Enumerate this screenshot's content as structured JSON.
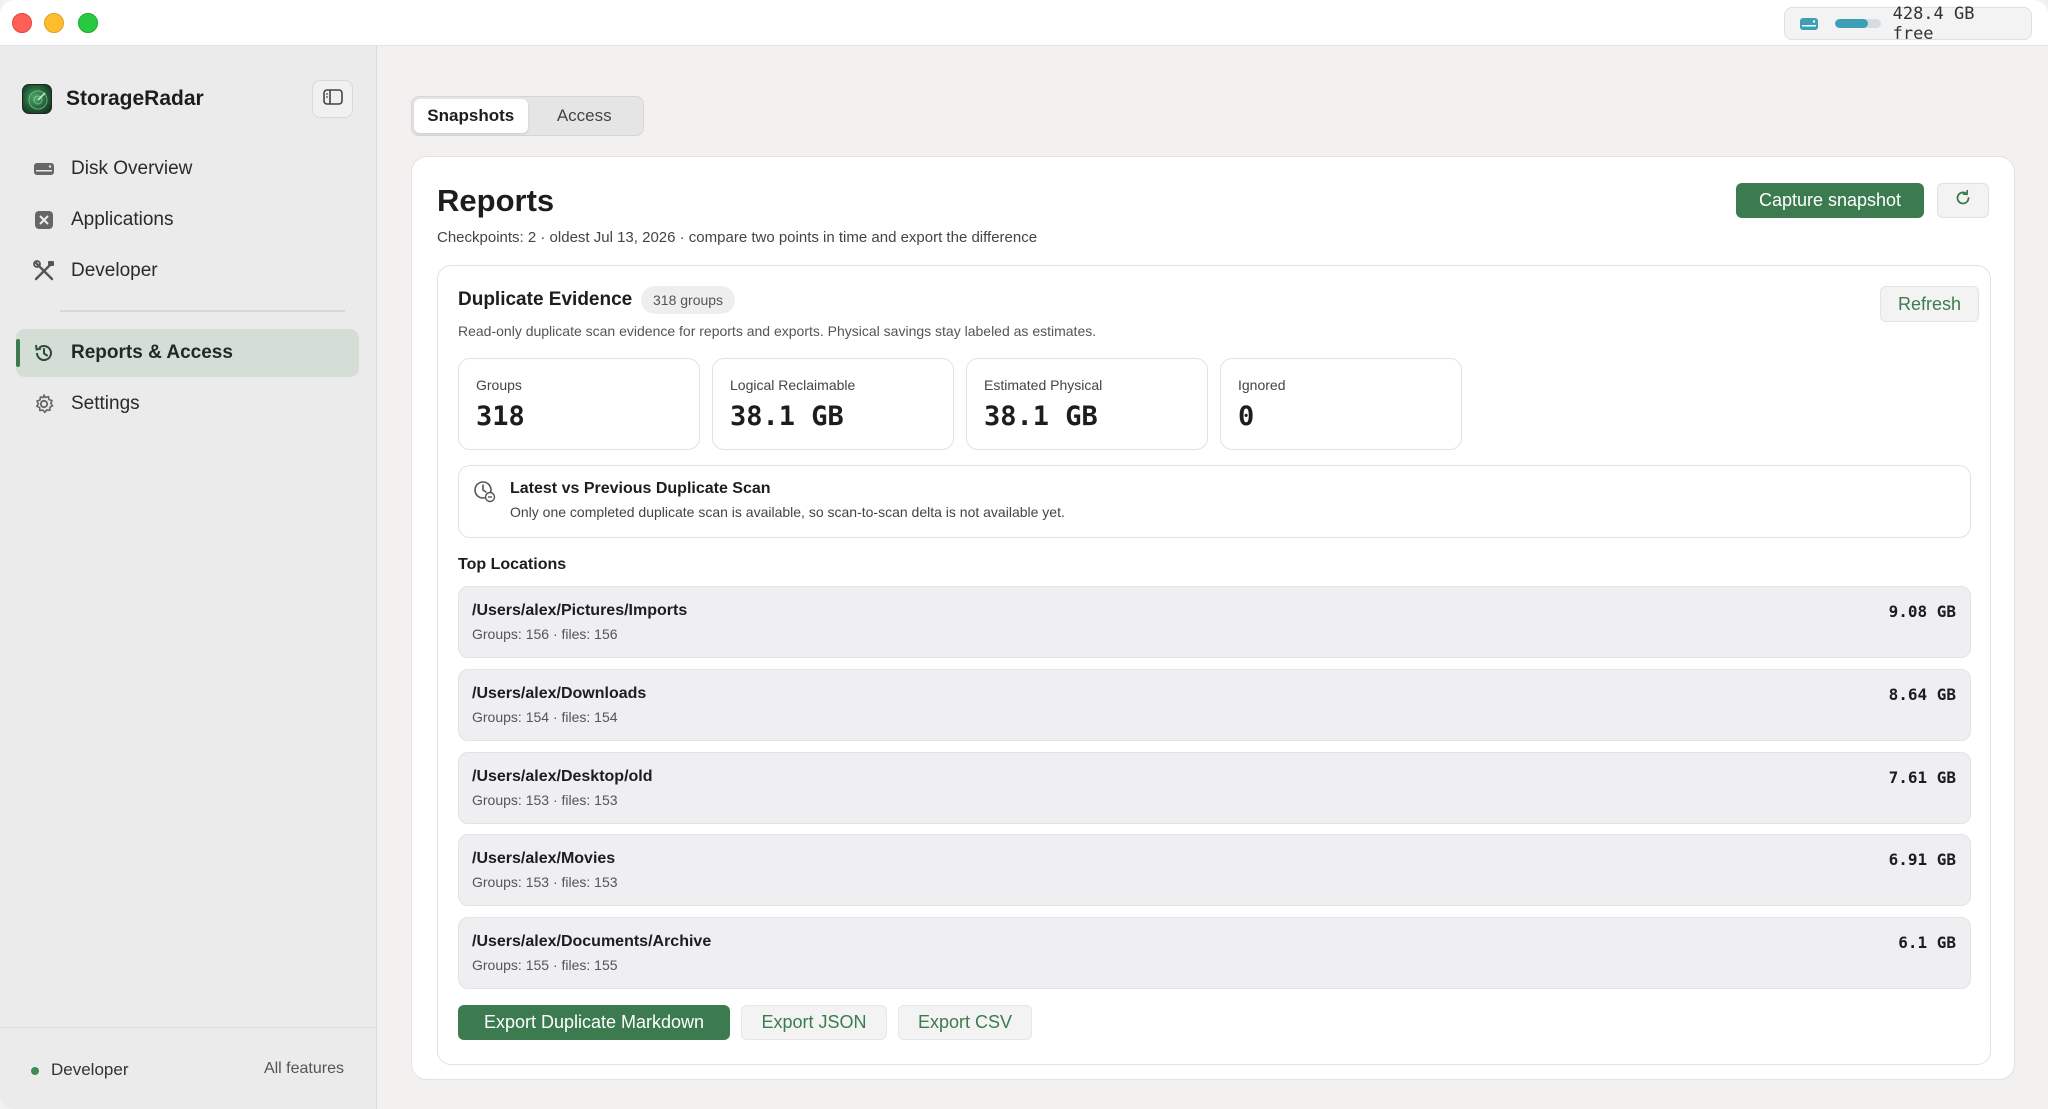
{
  "app": {
    "name": "StorageRadar"
  },
  "titlebar": {
    "disk_free": "428.4 GB free",
    "disk_used_fraction": 0.72
  },
  "sidebar": {
    "items": [
      {
        "label": "Disk Overview",
        "icon": "disk-icon"
      },
      {
        "label": "Applications",
        "icon": "applications-icon"
      },
      {
        "label": "Developer",
        "icon": "tools-icon"
      },
      {
        "label": "Reports & Access",
        "icon": "history-icon"
      },
      {
        "label": "Settings",
        "icon": "gear-icon"
      }
    ],
    "footer": {
      "mode": "Developer",
      "features": "All features"
    }
  },
  "tabs": {
    "snapshots": "Snapshots",
    "access": "Access"
  },
  "reports": {
    "title": "Reports",
    "subtitle": "Checkpoints: 2 · oldest Jul 13, 2026  ·  compare two points in time and export the difference",
    "capture_label": "Capture snapshot"
  },
  "duplicates": {
    "title": "Duplicate Evidence",
    "badge": "318 groups",
    "description": "Read-only duplicate scan evidence for reports and exports. Physical savings stay labeled as estimates.",
    "refresh_label": "Refresh",
    "stats": [
      {
        "label": "Groups",
        "value": "318"
      },
      {
        "label": "Logical Reclaimable",
        "value": "38.1 GB"
      },
      {
        "label": "Estimated Physical",
        "value": "38.1 GB"
      },
      {
        "label": "Ignored",
        "value": "0"
      }
    ],
    "compare": {
      "title": "Latest vs Previous Duplicate Scan",
      "text": "Only one completed duplicate scan is available, so scan-to-scan delta is not available yet."
    },
    "top_locations_label": "Top Locations",
    "locations": [
      {
        "path": "/Users/alex/Pictures/Imports",
        "meta": "Groups: 156 · files: 156",
        "size": "9.08 GB"
      },
      {
        "path": "/Users/alex/Downloads",
        "meta": "Groups: 154 · files: 154",
        "size": "8.64 GB"
      },
      {
        "path": "/Users/alex/Desktop/old",
        "meta": "Groups: 153 · files: 153",
        "size": "7.61 GB"
      },
      {
        "path": "/Users/alex/Movies",
        "meta": "Groups: 153 · files: 153",
        "size": "6.91 GB"
      },
      {
        "path": "/Users/alex/Documents/Archive",
        "meta": "Groups: 155 · files: 155",
        "size": "6.1 GB"
      }
    ],
    "export": {
      "markdown": "Export Duplicate Markdown",
      "json": "Export JSON",
      "csv": "Export CSV"
    }
  },
  "colors": {
    "accent": "#3b7b4f",
    "sidebar_active": "#d4ddd6",
    "disk_bar": "#3b9fb5"
  }
}
